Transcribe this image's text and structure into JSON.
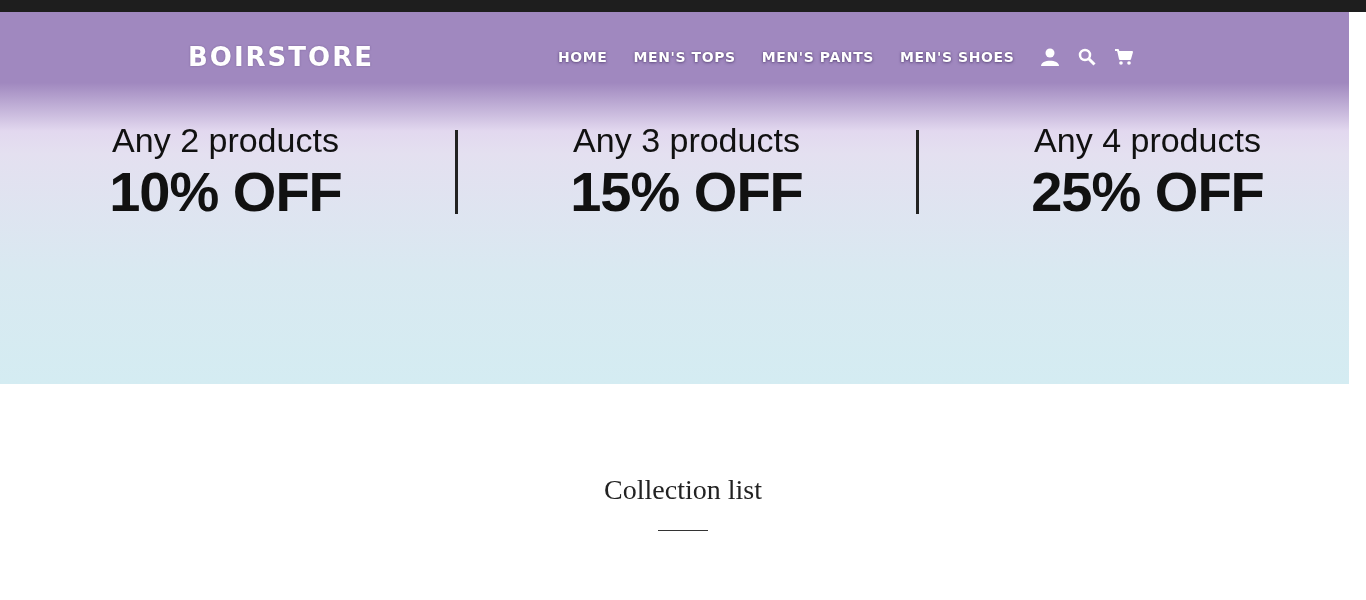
{
  "header": {
    "logo": "BOIRSTORE",
    "nav": [
      "HOME",
      "MEN'S TOPS",
      "MEN'S PANTS",
      "MEN'S SHOES"
    ]
  },
  "offers": [
    {
      "line1": "Any 2 products",
      "line2": "10% OFF"
    },
    {
      "line1": "Any 3 products",
      "line2": "15% OFF"
    },
    {
      "line1": "Any 4 products",
      "line2": "25% OFF"
    }
  ],
  "section": {
    "title": "Collection list"
  }
}
